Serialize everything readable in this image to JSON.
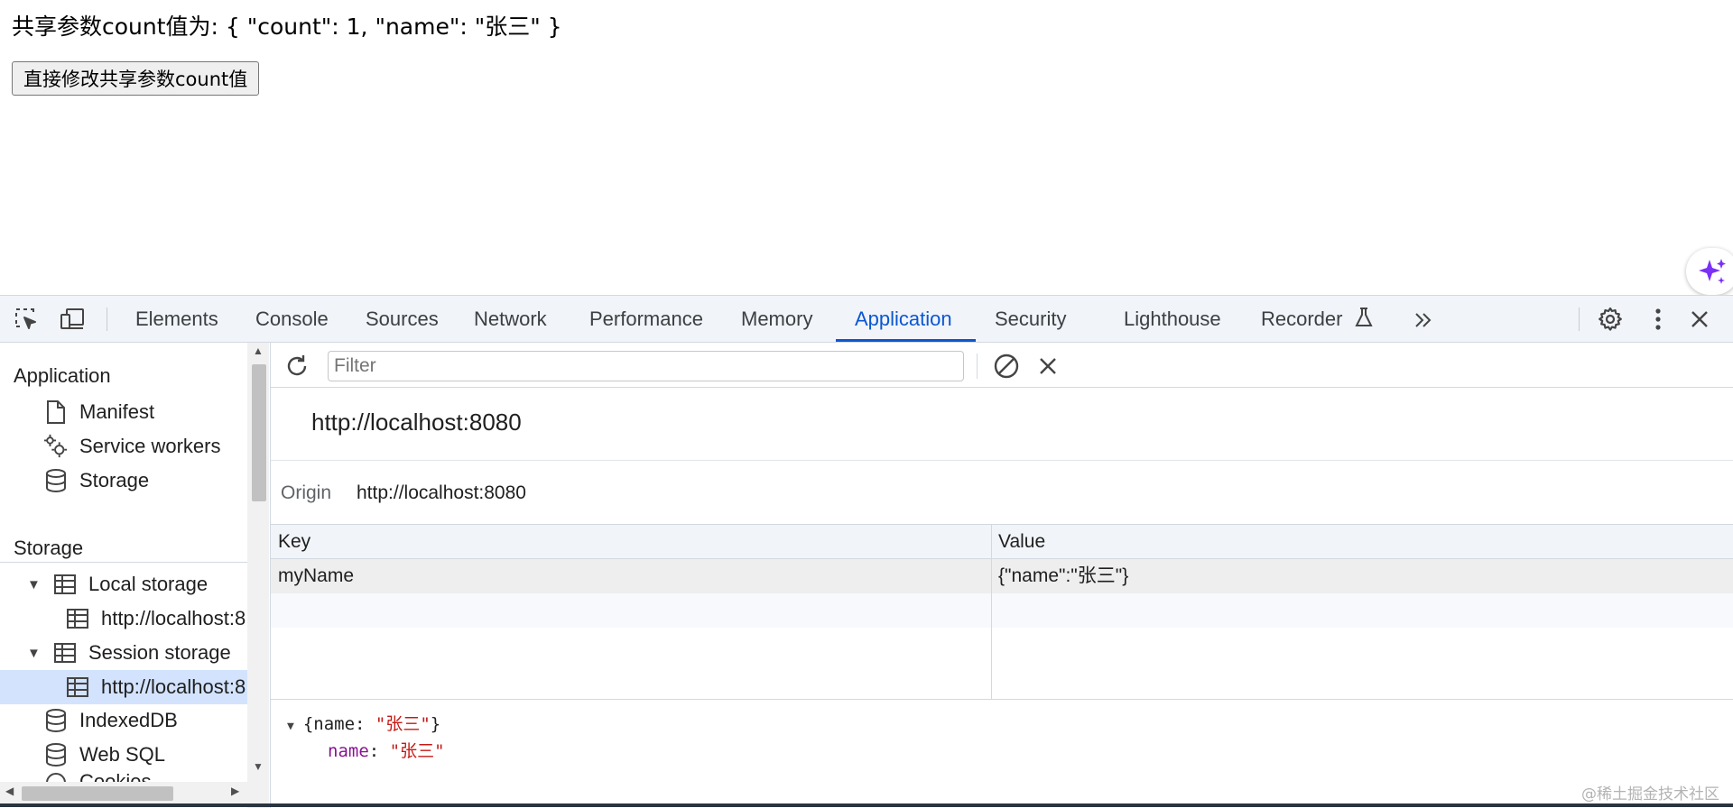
{
  "page": {
    "shared_text": "共享参数count值为: { \"count\": 1, \"name\": \"张三\" }",
    "button_label": "直接修改共享参数count值"
  },
  "devtools": {
    "tabs": [
      "Elements",
      "Console",
      "Sources",
      "Network",
      "Performance",
      "Memory",
      "Application",
      "Security",
      "Lighthouse",
      "Recorder"
    ],
    "active_tab": "Application",
    "sidebar": {
      "application_heading": "Application",
      "application_items": [
        "Manifest",
        "Service workers",
        "Storage"
      ],
      "storage_heading": "Storage",
      "local_storage": "Local storage",
      "local_storage_child": "http://localhost:8",
      "session_storage": "Session storage",
      "session_storage_child": "http://localhost:8",
      "indexeddb": "IndexedDB",
      "websql": "Web SQL",
      "cookies": "Cookies"
    },
    "filter_placeholder": "Filter",
    "origin_title": "http://localhost:8080",
    "origin_label": "Origin",
    "origin_value": "http://localhost:8080",
    "grid": {
      "columns": [
        "Key",
        "Value"
      ],
      "rows": [
        {
          "key": "myName",
          "value": "{\"name\":\"张三\"}"
        }
      ]
    },
    "preview": {
      "summary_open": "{name: ",
      "summary_value": "\"张三\"",
      "summary_close": "}",
      "prop_key": "name",
      "prop_value": "\"张三\""
    }
  },
  "watermark": "@稀土掘金技术社区",
  "colors": {
    "accent": "#0b57d0",
    "toolbar_bg": "#f1f4f9",
    "selected_bg": "#d3e3fd",
    "string": "#c41a16",
    "prop_key": "#881391"
  }
}
